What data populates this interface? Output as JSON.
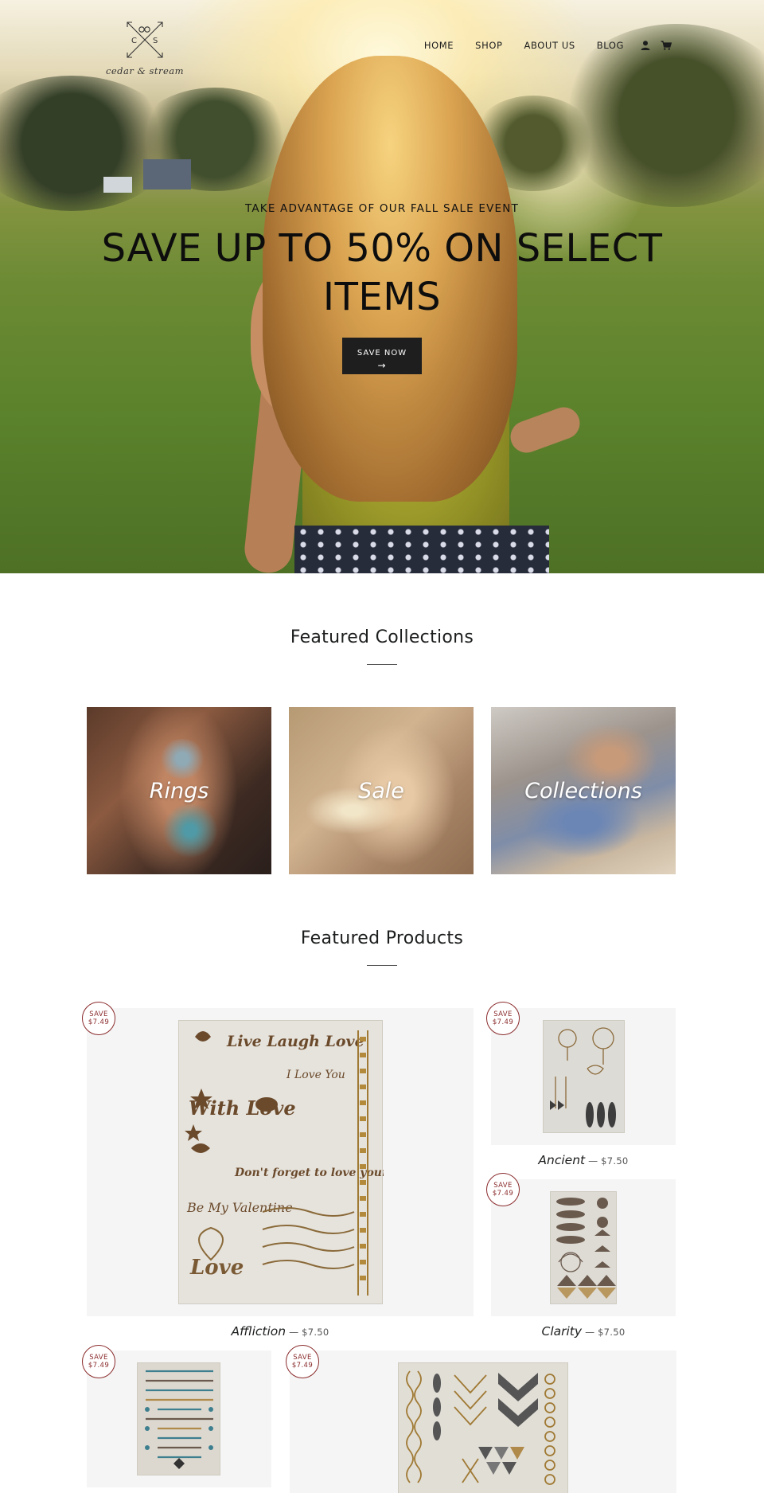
{
  "brand": {
    "name": "cedar & stream",
    "initials": [
      "C",
      "S"
    ]
  },
  "nav": {
    "items": [
      "HOME",
      "SHOP",
      "ABOUT US",
      "BLOG"
    ],
    "account_icon": "user-icon",
    "cart_icon": "cart-icon"
  },
  "hero": {
    "subtitle": "TAKE ADVANTAGE OF OUR FALL SALE EVENT",
    "title": "SAVE UP TO 50% ON SELECT ITEMS",
    "button_label": "SAVE NOW",
    "button_arrow": "→"
  },
  "featured_collections": {
    "title": "Featured Collections",
    "items": [
      {
        "label": "Rings"
      },
      {
        "label": "Sale"
      },
      {
        "label": "Collections"
      }
    ]
  },
  "featured_products": {
    "title": "Featured Products",
    "badge_save": "SAVE",
    "items": [
      {
        "name": "Affliction",
        "price": "$7.50",
        "badge": "$7.49"
      },
      {
        "name": "Ancient",
        "price": "$7.50",
        "badge": "$7.49"
      },
      {
        "name": "Clarity",
        "price": "$7.50",
        "badge": "$7.49"
      },
      {
        "badge": "$7.49"
      },
      {
        "badge": "$7.49"
      }
    ],
    "separator": "—"
  },
  "tattoo_sheet_text": {
    "line1": "Live Laugh Love",
    "line2": "I Love You",
    "line3": "With Love",
    "line4": "Be my Valentine",
    "line5": "Don't forget to love yourself",
    "line6": "Be My Valentine",
    "line7": "Love"
  },
  "colors": {
    "badge": "#8a2a2b",
    "button": "#1e1e1e",
    "product_bg": "#f5f5f5"
  }
}
